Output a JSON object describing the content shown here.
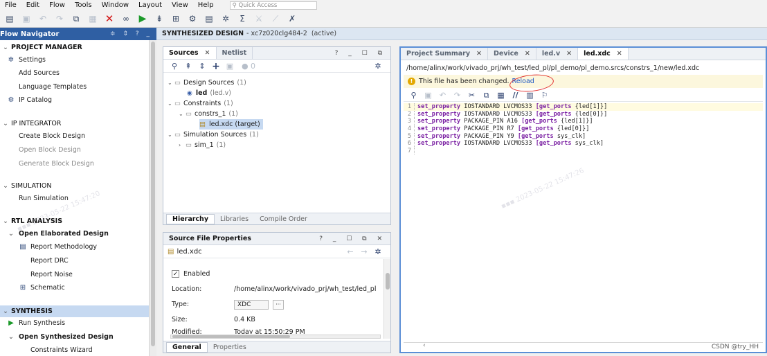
{
  "menubar": {
    "items": [
      "File",
      "Edit",
      "Flow",
      "Tools",
      "Window",
      "Layout",
      "View",
      "Help"
    ],
    "quick_access_placeholder": "Quick Access"
  },
  "flow_navigator": {
    "title": "Flow Navigator",
    "controls": "≑ ⇕ ? _",
    "sections": {
      "project_manager": {
        "label": "PROJECT MANAGER",
        "items": {
          "settings": "Settings",
          "add_sources": "Add Sources",
          "language_templates": "Language Templates",
          "ip_catalog": "IP Catalog"
        }
      },
      "ip_integrator": {
        "label": "IP INTEGRATOR",
        "items": {
          "create_block_design": "Create Block Design",
          "open_block_design": "Open Block Design",
          "generate_block_design": "Generate Block Design"
        }
      },
      "simulation": {
        "label": "SIMULATION",
        "items": {
          "run_simulation": "Run Simulation"
        }
      },
      "rtl_analysis": {
        "label": "RTL ANALYSIS",
        "open_elaborated": "Open Elaborated Design",
        "items": {
          "report_methodology": "Report Methodology",
          "report_drc": "Report DRC",
          "report_noise": "Report Noise",
          "schematic": "Schematic"
        }
      },
      "synthesis": {
        "label": "SYNTHESIS",
        "items": {
          "run_synthesis": "Run Synthesis",
          "open_synthesized": "Open Synthesized Design",
          "constraints_wizard": "Constraints Wizard"
        }
      }
    }
  },
  "header": {
    "title": "SYNTHESIZED DESIGN",
    "part": "- xc7z020clg484-2",
    "status": "(active)"
  },
  "sources": {
    "tabs": {
      "sources": "Sources",
      "netlist": "Netlist"
    },
    "controls": "? _ ☐ ⧉",
    "badge": "0",
    "tree": {
      "design_sources": {
        "label": "Design Sources",
        "count": "(1)"
      },
      "led": {
        "label": "led",
        "file": "(led.v)"
      },
      "constraints": {
        "label": "Constraints",
        "count": "(1)"
      },
      "constrs_1": {
        "label": "constrs_1",
        "count": "(1)"
      },
      "led_xdc": {
        "label": "led.xdc (target)"
      },
      "simulation_sources": {
        "label": "Simulation Sources",
        "count": "(1)"
      },
      "sim_1": {
        "label": "sim_1",
        "count": "(1)"
      }
    },
    "bottom_tabs": {
      "hierarchy": "Hierarchy",
      "libraries": "Libraries",
      "compile_order": "Compile Order"
    }
  },
  "props": {
    "title": "Source File Properties",
    "controls": "? _ ☐ ⧉ ✕",
    "file": "led.xdc",
    "enabled_label": "Enabled",
    "rows": {
      "location": {
        "label": "Location:",
        "value": "/home/alinx/work/vivado_prj/wh_test/led_pl"
      },
      "type": {
        "label": "Type:",
        "value": "XDC"
      },
      "size": {
        "label": "Size:",
        "value": "0.4 KB"
      },
      "modified": {
        "label": "Modified:",
        "value": "Today at 15:50:29 PM"
      }
    },
    "bottom_tabs": {
      "general": "General",
      "properties": "Properties"
    }
  },
  "editor": {
    "tabs": {
      "project_summary": "Project Summary",
      "device": "Device",
      "led_v": "led.v",
      "led_xdc": "led.xdc"
    },
    "path": "/home/alinx/work/vivado_prj/wh_test/led_pl/pl_demo/pl_demo.srcs/constrs_1/new/led.xdc",
    "notice": "This file has been changed.",
    "reload": "Reload",
    "lines": [
      {
        "n": "1",
        "kw": "set_property",
        "rest": " IOSTANDARD LVCMOS33 ",
        "kw2": "[get_ports",
        "rest2": " {led[1]}]"
      },
      {
        "n": "2",
        "kw": "set_property",
        "rest": " IOSTANDARD LVCMOS33 ",
        "kw2": "[get_ports",
        "rest2": " {led[0]}]"
      },
      {
        "n": "3",
        "kw": "set_property",
        "rest": " PACKAGE_PIN A16 ",
        "kw2": "[get_ports",
        "rest2": " {led[1]}]"
      },
      {
        "n": "4",
        "kw": "set_property",
        "rest": " PACKAGE_PIN R7 ",
        "kw2": "[get_ports",
        "rest2": " {led[0]}]"
      },
      {
        "n": "5",
        "kw": "set_property",
        "rest": " PACKAGE_PIN Y9 ",
        "kw2": "[get_ports",
        "rest2": " sys_clk]"
      },
      {
        "n": "6",
        "kw": "set_property",
        "rest": " IOSTANDARD LVCMOS33 ",
        "kw2": "[get_ports",
        "rest2": " sys_clk]"
      },
      {
        "n": "7",
        "kw": "",
        "rest": "",
        "kw2": "",
        "rest2": ""
      }
    ]
  },
  "watermark": "CSDN @try_HH",
  "colors": {
    "nav_header": "#2f5fa3",
    "selection": "#c6d9f1",
    "active_border": "#5b8fd6",
    "keyword": "#7a1fa2",
    "reload_link": "#1a56c4",
    "annotation": "#e23232"
  }
}
